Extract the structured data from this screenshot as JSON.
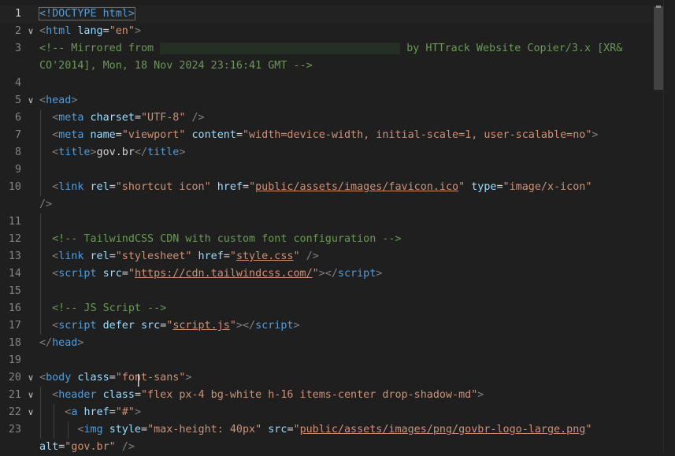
{
  "editor": {
    "lines": [
      {
        "num": "1",
        "fold": "",
        "active": true,
        "guides": 0,
        "tokens": [
          [
            "tag",
            "<!DOCTYPE html>"
          ]
        ]
      },
      {
        "num": "2",
        "fold": "v",
        "guides": 0,
        "tokens": [
          [
            "punct",
            "<"
          ],
          [
            "tag",
            "html "
          ],
          [
            "attr",
            "lang"
          ],
          [
            "text",
            "="
          ],
          [
            "str",
            "\"en\""
          ],
          [
            "punct",
            ">"
          ]
        ]
      },
      {
        "num": "3",
        "fold": "",
        "guides": 0,
        "tokens": [
          [
            "cmt",
            "<!-- Mirrored from "
          ],
          [
            "redact",
            ""
          ],
          [
            "cmt",
            " by HTTrack Website Copier/3.x [XR&"
          ]
        ]
      },
      {
        "num": "",
        "fold": "",
        "guides": 0,
        "tokens": [
          [
            "cmt",
            "CO'2014], Mon, 18 Nov 2024 23:16:41 GMT -->"
          ]
        ]
      },
      {
        "num": "4",
        "fold": "",
        "guides": 0,
        "tokens": []
      },
      {
        "num": "5",
        "fold": "v",
        "guides": 0,
        "tokens": [
          [
            "punct",
            "<"
          ],
          [
            "tag",
            "head"
          ],
          [
            "punct",
            ">"
          ]
        ]
      },
      {
        "num": "6",
        "fold": "",
        "guides": 1,
        "tokens": [
          [
            "punct",
            "  <"
          ],
          [
            "tag",
            "meta "
          ],
          [
            "attr",
            "charset"
          ],
          [
            "text",
            "="
          ],
          [
            "str",
            "\"UTF-8\""
          ],
          [
            "punct",
            " />"
          ]
        ]
      },
      {
        "num": "7",
        "fold": "",
        "guides": 1,
        "tokens": [
          [
            "punct",
            "  <"
          ],
          [
            "tag",
            "meta "
          ],
          [
            "attr",
            "name"
          ],
          [
            "text",
            "="
          ],
          [
            "str",
            "\"viewport\""
          ],
          [
            "attr",
            " content"
          ],
          [
            "text",
            "="
          ],
          [
            "str",
            "\"width=device-width, initial-scale=1, user-scalable=no\""
          ],
          [
            "punct",
            ">"
          ]
        ]
      },
      {
        "num": "8",
        "fold": "",
        "guides": 1,
        "tokens": [
          [
            "punct",
            "  <"
          ],
          [
            "tag",
            "title"
          ],
          [
            "punct",
            ">"
          ],
          [
            "text",
            "gov.br"
          ],
          [
            "punct",
            "</"
          ],
          [
            "tag",
            "title"
          ],
          [
            "punct",
            ">"
          ]
        ]
      },
      {
        "num": "9",
        "fold": "",
        "guides": 1,
        "tokens": []
      },
      {
        "num": "10",
        "fold": "",
        "guides": 1,
        "tokens": [
          [
            "punct",
            "  <"
          ],
          [
            "tag",
            "link "
          ],
          [
            "attr",
            "rel"
          ],
          [
            "text",
            "="
          ],
          [
            "str",
            "\"shortcut icon\""
          ],
          [
            "attr",
            " href"
          ],
          [
            "text",
            "="
          ],
          [
            "str",
            "\""
          ],
          [
            "link",
            "public/assets/images/favicon.ico"
          ],
          [
            "str",
            "\""
          ],
          [
            "attr",
            " type"
          ],
          [
            "text",
            "="
          ],
          [
            "str",
            "\"image/x-icon\""
          ]
        ]
      },
      {
        "num": "",
        "fold": "",
        "guides": 0,
        "tokens": [
          [
            "punct",
            "/>"
          ]
        ]
      },
      {
        "num": "11",
        "fold": "",
        "guides": 1,
        "tokens": []
      },
      {
        "num": "12",
        "fold": "",
        "guides": 1,
        "tokens": [
          [
            "cmt",
            "  <!-- TailwindCSS CDN with custom font configuration -->"
          ]
        ]
      },
      {
        "num": "13",
        "fold": "",
        "guides": 1,
        "tokens": [
          [
            "punct",
            "  <"
          ],
          [
            "tag",
            "link "
          ],
          [
            "attr",
            "rel"
          ],
          [
            "text",
            "="
          ],
          [
            "str",
            "\"stylesheet\""
          ],
          [
            "attr",
            " href"
          ],
          [
            "text",
            "="
          ],
          [
            "str",
            "\""
          ],
          [
            "link",
            "style.css"
          ],
          [
            "str",
            "\""
          ],
          [
            "punct",
            " />"
          ]
        ]
      },
      {
        "num": "14",
        "fold": "",
        "guides": 1,
        "tokens": [
          [
            "punct",
            "  <"
          ],
          [
            "tag",
            "script "
          ],
          [
            "attr",
            "src"
          ],
          [
            "text",
            "="
          ],
          [
            "str",
            "\""
          ],
          [
            "link",
            "https://cdn.tailwindcss.com/"
          ],
          [
            "str",
            "\""
          ],
          [
            "punct",
            "></"
          ],
          [
            "tag",
            "script"
          ],
          [
            "punct",
            ">"
          ]
        ]
      },
      {
        "num": "15",
        "fold": "",
        "guides": 1,
        "tokens": []
      },
      {
        "num": "16",
        "fold": "",
        "guides": 1,
        "tokens": [
          [
            "cmt",
            "  <!-- JS Script -->"
          ]
        ]
      },
      {
        "num": "17",
        "fold": "",
        "guides": 1,
        "tokens": [
          [
            "punct",
            "  <"
          ],
          [
            "tag",
            "script "
          ],
          [
            "attr",
            "defer "
          ],
          [
            "attr",
            "src"
          ],
          [
            "text",
            "="
          ],
          [
            "str",
            "\""
          ],
          [
            "link",
            "script.js"
          ],
          [
            "str",
            "\""
          ],
          [
            "punct",
            "></"
          ],
          [
            "tag",
            "script"
          ],
          [
            "punct",
            ">"
          ]
        ]
      },
      {
        "num": "18",
        "fold": "",
        "guides": 0,
        "tokens": [
          [
            "punct",
            "</"
          ],
          [
            "tag",
            "head"
          ],
          [
            "punct",
            ">"
          ]
        ]
      },
      {
        "num": "19",
        "fold": "",
        "guides": 0,
        "tokens": []
      },
      {
        "num": "20",
        "fold": "v",
        "guides": 0,
        "tokens": [
          [
            "punct",
            "<"
          ],
          [
            "tag",
            "body "
          ],
          [
            "attr",
            "class"
          ],
          [
            "text",
            "="
          ],
          [
            "str",
            "\"font-sans\""
          ],
          [
            "punct",
            ">"
          ]
        ]
      },
      {
        "num": "21",
        "fold": "v",
        "guides": 1,
        "tokens": [
          [
            "punct",
            "  <"
          ],
          [
            "tag",
            "header "
          ],
          [
            "attr",
            "class"
          ],
          [
            "text",
            "="
          ],
          [
            "str",
            "\"flex px-4 bg-white h-16 items-center drop-shadow-md\""
          ],
          [
            "punct",
            ">"
          ]
        ]
      },
      {
        "num": "22",
        "fold": "v",
        "guides": 2,
        "tokens": [
          [
            "punct",
            "    <"
          ],
          [
            "tag",
            "a "
          ],
          [
            "attr",
            "href"
          ],
          [
            "text",
            "="
          ],
          [
            "str",
            "\"#\""
          ],
          [
            "punct",
            ">"
          ]
        ]
      },
      {
        "num": "23",
        "fold": "",
        "guides": 3,
        "tokens": [
          [
            "punct",
            "      <"
          ],
          [
            "tag",
            "img "
          ],
          [
            "attr",
            "style"
          ],
          [
            "text",
            "="
          ],
          [
            "str",
            "\"max-height: 40px\""
          ],
          [
            "attr",
            " src"
          ],
          [
            "text",
            "="
          ],
          [
            "str",
            "\""
          ],
          [
            "link",
            "public/assets/images/png/govbr-logo-large.png"
          ],
          [
            "str",
            "\""
          ]
        ]
      },
      {
        "num": "",
        "fold": "",
        "guides": 0,
        "tokens": [
          [
            "attr",
            "alt"
          ],
          [
            "text",
            "="
          ],
          [
            "str",
            "\"gov.br\""
          ],
          [
            "punct",
            " />"
          ]
        ]
      }
    ]
  }
}
